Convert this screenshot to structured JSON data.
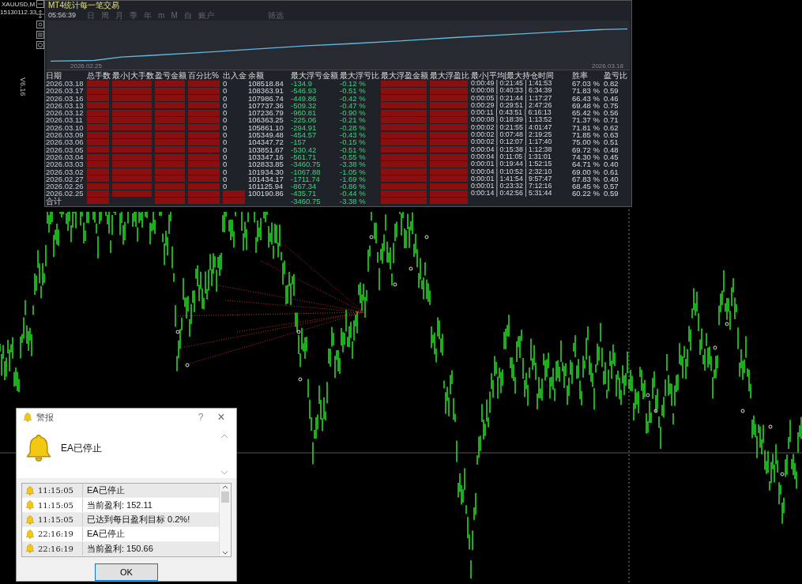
{
  "chart_header": {
    "symbol": "XAUUSD,M",
    "value": "15130112.33"
  },
  "stats_panel": {
    "title": "MT4统计每一笔交易",
    "clock": "05:56:39",
    "version": "V6.16",
    "tabs": [
      "日",
      "周",
      "月",
      "季",
      "年",
      "m",
      "M",
      "自",
      "账户",
      "筛选"
    ],
    "equity_chart": {
      "start_label": "2026.02.25",
      "end_label": "2026.03.18"
    },
    "columns": [
      {
        "label": "日期",
        "kind": "date"
      },
      {
        "label": "总手数",
        "kind": "plain"
      },
      {
        "label": "最小|大手数",
        "kind": "plain"
      },
      {
        "label": "盈亏金额",
        "kind": "plain"
      },
      {
        "label": "百分比%",
        "kind": "plain"
      },
      {
        "label": "出入金",
        "kind": "plain"
      },
      {
        "label": "余额",
        "kind": "plain"
      },
      {
        "label": "最大浮亏金额",
        "kind": "loss"
      },
      {
        "label": "最大浮亏比",
        "kind": "loss"
      },
      {
        "label": "最大浮盈金额",
        "kind": "plain"
      },
      {
        "label": "最大浮盈比",
        "kind": "plain"
      },
      {
        "label": "最小|平均|最大持仓时间",
        "kind": "plain"
      },
      {
        "label": "胜率",
        "kind": "plain"
      },
      {
        "label": "盈亏比",
        "kind": "plain"
      }
    ],
    "rows": [
      {
        "cells": [
          "2026.03.18",
          {
            "redacted": true
          },
          {
            "redacted": true
          },
          {
            "redacted": true
          },
          {
            "redacted": true
          },
          "0",
          "108518.84",
          "-134.9",
          "-0.12 %",
          {
            "redacted": true
          },
          {
            "redacted": true
          },
          "0:00:49 | 0:21:45 | 1:41:53",
          "67.03 %",
          "0.82"
        ]
      },
      {
        "cells": [
          "2026.03.17",
          {
            "redacted": true
          },
          {
            "redacted": true
          },
          {
            "redacted": true
          },
          {
            "redacted": true
          },
          "0",
          "108363.91",
          "-546.93",
          "-0.51 %",
          {
            "redacted": true
          },
          {
            "redacted": true
          },
          "0:00:08 | 0:40:33 | 6:34:39",
          "71.83 %",
          "0.59"
        ]
      },
      {
        "cells": [
          "2026.03.16",
          {
            "redacted": true
          },
          {
            "redacted": true
          },
          {
            "redacted": true
          },
          {
            "redacted": true
          },
          "0",
          "107986.74",
          "-449.86",
          "-0.42 %",
          {
            "redacted": true
          },
          {
            "redacted": true
          },
          "0:00:05 | 0:21:44 | 1:17:27",
          "66.43 %",
          "0.46"
        ]
      },
      {
        "cells": [
          "2026.03.13",
          {
            "redacted": true
          },
          {
            "redacted": true
          },
          {
            "redacted": true
          },
          {
            "redacted": true
          },
          "0",
          "107737.36",
          "-509.32",
          "-0.47 %",
          {
            "redacted": true
          },
          {
            "redacted": true
          },
          "0:00:29 | 0:29:51 | 2:47:26",
          "69.48 %",
          "0.75"
        ]
      },
      {
        "cells": [
          "2026.03.12",
          {
            "redacted": true
          },
          {
            "redacted": true
          },
          {
            "redacted": true
          },
          {
            "redacted": true
          },
          "0",
          "107236.79",
          "-960.81",
          "-0.90 %",
          {
            "redacted": true
          },
          {
            "redacted": true
          },
          "0:00:11 | 0:43:51 | 6:16:13",
          "65.42 %",
          "0.56"
        ]
      },
      {
        "cells": [
          "2026.03.11",
          {
            "redacted": true
          },
          {
            "redacted": true
          },
          {
            "redacted": true
          },
          {
            "redacted": true
          },
          "0",
          "106363.25",
          "-225.06",
          "-0.21 %",
          {
            "redacted": true
          },
          {
            "redacted": true
          },
          "0:00:08 | 0:18:39 | 1:13:52",
          "71.37 %",
          "0.71"
        ]
      },
      {
        "cells": [
          "2026.03.10",
          {
            "redacted": true
          },
          {
            "redacted": true
          },
          {
            "redacted": true
          },
          {
            "redacted": true
          },
          "0",
          "105861.10",
          "-294.91",
          "-0.28 %",
          {
            "redacted": true
          },
          {
            "redacted": true
          },
          "0:00:02 | 0:21:55 | 4:01:47",
          "71.81 %",
          "0.62"
        ]
      },
      {
        "cells": [
          "2026.03.09",
          {
            "redacted": true
          },
          {
            "redacted": true
          },
          {
            "redacted": true
          },
          {
            "redacted": true
          },
          "0",
          "105349.48",
          "-454.57",
          "-0.43 %",
          {
            "redacted": true
          },
          {
            "redacted": true
          },
          "0:00:02 | 0:07:48 | 2:19:25",
          "71.85 %",
          "0.63"
        ]
      },
      {
        "cells": [
          "2026.03.06",
          {
            "redacted": true
          },
          {
            "redacted": true
          },
          {
            "redacted": true
          },
          {
            "redacted": true
          },
          "0",
          "104347.72",
          "-157",
          "-0.15 %",
          {
            "redacted": true
          },
          {
            "redacted": true
          },
          "0:00:02 | 0:12:07 | 1:17:40",
          "75.00 %",
          "0.51"
        ]
      },
      {
        "cells": [
          "2026.03.05",
          {
            "redacted": true
          },
          {
            "redacted": true
          },
          {
            "redacted": true
          },
          {
            "redacted": true
          },
          "0",
          "103851.67",
          "-530.42",
          "-0.51 %",
          {
            "redacted": true
          },
          {
            "redacted": true
          },
          "0:00:04 | 0:15:38 | 1:12:38",
          "69.72 %",
          "0.48"
        ]
      },
      {
        "cells": [
          "2026.03.04",
          {
            "redacted": true
          },
          {
            "redacted": true
          },
          {
            "redacted": true
          },
          {
            "redacted": true
          },
          "0",
          "103347.16",
          "-561.71",
          "-0.55 %",
          {
            "redacted": true
          },
          {
            "redacted": true
          },
          "0:00:04 | 0:11:05 | 1:31:01",
          "74.30 %",
          "0.45"
        ]
      },
      {
        "cells": [
          "2026.03.03",
          {
            "redacted": true
          },
          {
            "redacted": true
          },
          {
            "redacted": true
          },
          {
            "redacted": true
          },
          "0",
          "102833.85",
          "-3460.75",
          "-3.38 %",
          {
            "redacted": true
          },
          {
            "redacted": true
          },
          "0:00:01 | 0:19:44 | 1:52:15",
          "64.71 %",
          "0.40"
        ]
      },
      {
        "cells": [
          "2026.03.02",
          {
            "redacted": true
          },
          {
            "redacted": true
          },
          {
            "redacted": true
          },
          {
            "redacted": true
          },
          "0",
          "101934.30",
          "-1067.88",
          "-1.05 %",
          {
            "redacted": true
          },
          {
            "redacted": true
          },
          "0:00:04 | 0:10:52 | 2:32:10",
          "69.00 %",
          "0.61"
        ]
      },
      {
        "cells": [
          "2026.02.27",
          {
            "redacted": true
          },
          {
            "redacted": true
          },
          {
            "redacted": true
          },
          {
            "redacted": true
          },
          "0",
          "101434.17",
          "-1711.74",
          "-1.69 %",
          {
            "redacted": true
          },
          {
            "redacted": true
          },
          "0:00:01 | 1:41:54 | 9:57:47",
          "67.83 %",
          "0.40"
        ]
      },
      {
        "cells": [
          "2026.02.26",
          {
            "redacted": true
          },
          {
            "redacted": true
          },
          {
            "redacted": true
          },
          {
            "redacted": true
          },
          "0",
          "101125.94",
          "-867.34",
          "-0.86 %",
          {
            "redacted": true
          },
          {
            "redacted": true
          },
          "0:00:01 | 0:23:32 | 7:12:16",
          "68.45 %",
          "0.57"
        ]
      },
      {
        "cells": [
          "2026.02.25",
          {
            "redacted": true
          },
          {
            "redacted": true
          },
          {
            "redacted": true
          },
          {
            "redacted": true
          },
          {
            "redacted": true
          },
          "100190.86",
          "-435.71",
          "-0.44 %",
          {
            "redacted": true
          },
          {
            "redacted": true
          },
          "0:00:14 | 0:42:56 | 5:31:44",
          "60.22 %",
          "0.59"
        ]
      },
      {
        "cells": [
          "合计",
          {
            "redacted": true
          },
          null,
          {
            "redacted": true
          },
          {
            "redacted": true
          },
          {
            "redacted": true
          },
          null,
          "-3460.75",
          "-3.38 %",
          {
            "redacted": true
          },
          {
            "redacted": true
          },
          null,
          null,
          null
        ]
      }
    ]
  },
  "alert_dialog": {
    "title": "警报",
    "help": "?",
    "close": "×",
    "message": "EA已停止",
    "log": [
      {
        "time": "11:15:05",
        "text": "EA已停止"
      },
      {
        "time": "11:15:05",
        "text": "当前盈利: 152.11"
      },
      {
        "time": "11:15:05",
        "text": "已达到每日盈利目标 0.2%!"
      },
      {
        "time": "22:16:19",
        "text": "EA已停止"
      },
      {
        "time": "22:16:19",
        "text": "当前盈利: 150.66"
      }
    ],
    "ok_button": "OK"
  }
}
